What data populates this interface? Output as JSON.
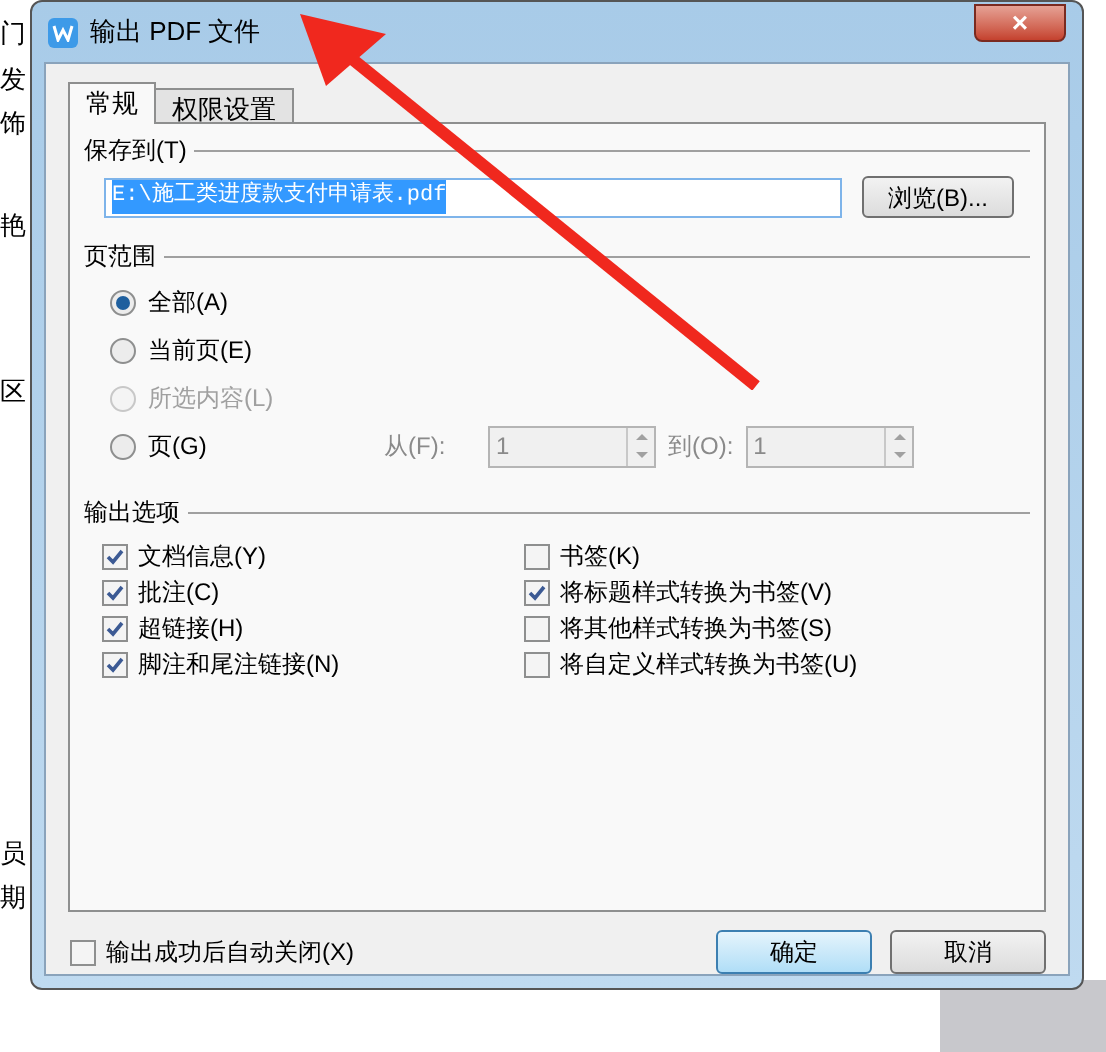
{
  "background_document": {
    "fragments": [
      "门",
      "发",
      "饰",
      "艳",
      "区",
      "员",
      "期"
    ]
  },
  "window": {
    "title": "输出 PDF 文件",
    "close": "×"
  },
  "tabs": [
    {
      "label": "常规",
      "selected": true
    },
    {
      "label": "权限设置",
      "selected": false
    }
  ],
  "save_to": {
    "label": "保存到(T)",
    "value": "E:\\施工类进度款支付申请表.pdf",
    "browse": "浏览(B)..."
  },
  "page_range": {
    "label": "页范围",
    "options": [
      {
        "label": "全部(A)",
        "selected": true,
        "disabled": false
      },
      {
        "label": "当前页(E)",
        "selected": false,
        "disabled": false
      },
      {
        "label": "所选内容(L)",
        "selected": false,
        "disabled": true
      },
      {
        "label": "页(G)",
        "selected": false,
        "disabled": false
      }
    ],
    "from_label": "从(F):",
    "from_value": "1",
    "to_label": "到(O):",
    "to_value": "1",
    "spin_disabled": true
  },
  "output_options": {
    "label": "输出选项",
    "left": [
      {
        "label": "文档信息(Y)",
        "checked": true
      },
      {
        "label": "批注(C)",
        "checked": true
      },
      {
        "label": "超链接(H)",
        "checked": true
      },
      {
        "label": "脚注和尾注链接(N)",
        "checked": true
      }
    ],
    "right": [
      {
        "label": "书签(K)",
        "checked": false
      },
      {
        "label": "将标题样式转换为书签(V)",
        "checked": true
      },
      {
        "label": "将其他样式转换为书签(S)",
        "checked": false
      },
      {
        "label": "将自定义样式转换为书签(U)",
        "checked": false
      }
    ]
  },
  "auto_close": {
    "label": "输出成功后自动关闭(X)",
    "checked": false
  },
  "buttons": [
    {
      "label": "确定",
      "default": true
    },
    {
      "label": "取消",
      "default": false
    }
  ]
}
